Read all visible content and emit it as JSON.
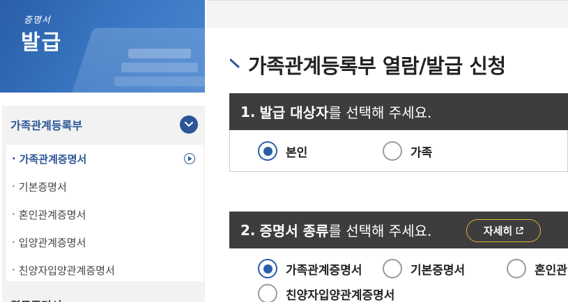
{
  "banner": {
    "sub": "증명서",
    "main": "발급"
  },
  "menu": {
    "header": "가족관계등록부",
    "items": [
      {
        "label": "가족관계증명서",
        "active": true
      },
      {
        "label": "기본증명서",
        "active": false
      },
      {
        "label": "혼인관계증명서",
        "active": false
      },
      {
        "label": "입양관계증명서",
        "active": false
      },
      {
        "label": "친양자입양관계증명서",
        "active": false
      }
    ],
    "next_header": "열무증명서"
  },
  "page": {
    "title": "가족관계등록부 열람/발급 신청"
  },
  "section1": {
    "number": "1.",
    "bold": "발급 대상자",
    "rest": "를 선택해 주세요.",
    "options": [
      {
        "label": "본인",
        "selected": true
      },
      {
        "label": "가족",
        "selected": false
      }
    ]
  },
  "section2": {
    "number": "2.",
    "bold": "증명서 종류",
    "rest": "를 선택해 주세요.",
    "detail_button": "자세히",
    "options": [
      {
        "label": "가족관계증명서",
        "selected": true
      },
      {
        "label": "기본증명서",
        "selected": false
      },
      {
        "label": "혼인관",
        "selected": false
      },
      {
        "label": "친양자입양관계증명서",
        "selected": false
      }
    ]
  },
  "colors": {
    "primary": "#2b5597",
    "bar": "#3d3d3d",
    "accent_border": "#e0b43a"
  }
}
